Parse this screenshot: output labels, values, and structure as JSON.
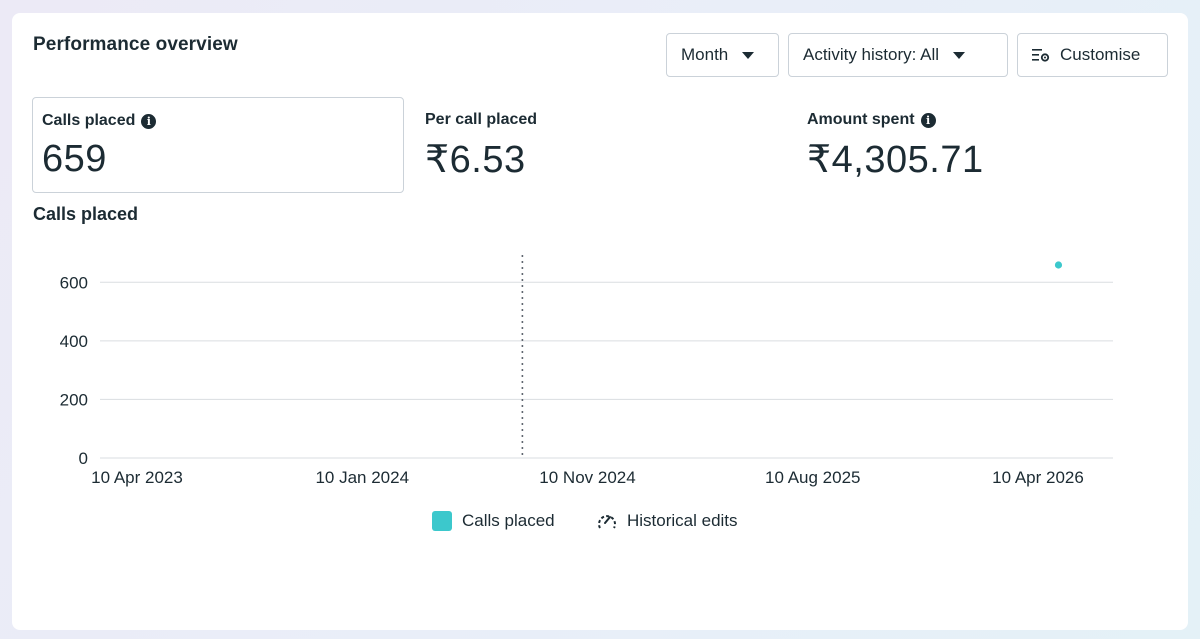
{
  "header": {
    "title": "Performance overview",
    "month_label": "Month",
    "activity_label": "Activity history: All",
    "customise_label": "Customise"
  },
  "metrics": [
    {
      "label": "Calls placed",
      "value": "659",
      "info": true,
      "selected": true
    },
    {
      "label": "Per call placed",
      "value": "₹6.53",
      "info": false,
      "selected": false
    },
    {
      "label": "Amount spent",
      "value": "₹4,305.71",
      "info": true,
      "selected": false
    }
  ],
  "colors": {
    "series": "#3cc8cc",
    "grid": "#dadde1",
    "text": "#1c2b33"
  },
  "chart_data": {
    "type": "scatter",
    "title": "Calls placed",
    "xlabel": "",
    "ylabel": "",
    "x_ticks": [
      "10 Apr 2023",
      "10 Jan 2024",
      "10 Nov 2024",
      "10 Aug 2025",
      "10 Apr 2026"
    ],
    "x_range": [
      "2023-04-10",
      "2026-04-10"
    ],
    "y_ticks": [
      0,
      200,
      400,
      600
    ],
    "ylim": [
      0,
      700
    ],
    "grid": true,
    "marker_date": "2024-07-10",
    "series": [
      {
        "name": "Calls placed",
        "points": [
          {
            "x": "2026-02-10",
            "y": 659
          }
        ]
      }
    ],
    "legend": [
      "Calls placed",
      "Historical edits"
    ],
    "legend_position": "bottom-center"
  }
}
